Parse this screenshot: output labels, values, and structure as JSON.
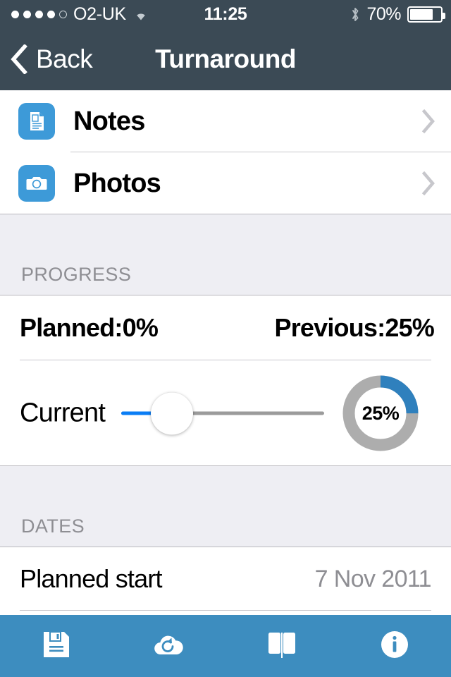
{
  "statusbar": {
    "carrier": "O2-UK",
    "signal_filled": 4,
    "signal_total": 5,
    "wifi_icon": "wifi-icon",
    "time": "11:25",
    "bluetooth_icon": "bluetooth-icon",
    "battery_percent": "70%",
    "battery_level": 70
  },
  "navbar": {
    "back_label": "Back",
    "back_icon": "chevron-left-icon",
    "title": "Turnaround"
  },
  "list": {
    "items": [
      {
        "label": "Notes",
        "icon": "document-icon",
        "accessory": "chevron-right-icon"
      },
      {
        "label": "Photos",
        "icon": "camera-icon",
        "accessory": "chevron-right-icon"
      }
    ]
  },
  "progress": {
    "header": "PROGRESS",
    "planned": "Planned:0%",
    "previous": "Previous:25%",
    "slider_label": "Current",
    "slider_value": 25,
    "donut_label": "25%",
    "donut_value": 25
  },
  "dates": {
    "header": "DATES",
    "rows": [
      {
        "label": "Planned start",
        "value": "7 Nov 2011"
      }
    ]
  },
  "toolbar": {
    "items": [
      {
        "name": "save-button",
        "icon": "floppy-disk-icon"
      },
      {
        "name": "sync-button",
        "icon": "cloud-refresh-icon"
      },
      {
        "name": "book-button",
        "icon": "open-book-icon"
      },
      {
        "name": "info-button",
        "icon": "info-circle-icon"
      }
    ]
  },
  "colors": {
    "navbar": "#3b4a55",
    "toolbar": "#3d8dbf",
    "accent": "#0a7df5",
    "icon_tile": "#3d9ad8",
    "donut_fill": "#2f80bd",
    "donut_track": "#adadad",
    "section_bg": "#eeeef3"
  }
}
